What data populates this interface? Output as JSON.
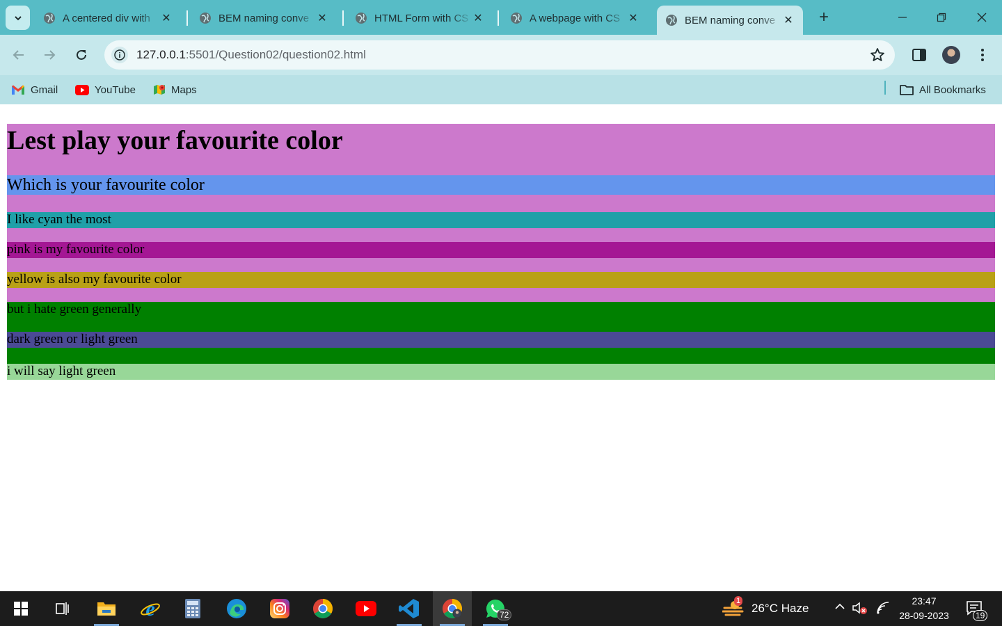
{
  "browser": {
    "tabs": [
      {
        "title": "A centered div with",
        "active": false
      },
      {
        "title": "BEM naming conve",
        "active": false
      },
      {
        "title": "HTML Form with CS",
        "active": false
      },
      {
        "title": "A webpage with CS",
        "active": false
      },
      {
        "title": "BEM naming conve",
        "active": true
      }
    ],
    "close_glyph": "✕",
    "new_tab_glyph": "+",
    "url_host": "127.0.0.1",
    "url_path": ":5501/Question02/question02.html",
    "bookmarks": [
      {
        "label": "Gmail",
        "icon": "gmail-icon"
      },
      {
        "label": "YouTube",
        "icon": "youtube-icon"
      },
      {
        "label": "Maps",
        "icon": "maps-icon"
      }
    ],
    "all_bookmarks_label": "All Bookmarks"
  },
  "page": {
    "heading": "Lest play your favourite color",
    "subheading": "Which is your favourite color",
    "rows": {
      "cyan": "I like cyan the most",
      "pink": "pink is my favourite color",
      "yellow": "yellow is also my favourite color",
      "green": "but i hate green generally",
      "dark": "dark green or light green",
      "light": "i will say light green"
    },
    "colors": {
      "container": "#cc79cc",
      "subheading": "#6495ed",
      "cyan": "#20a0a8",
      "pink": "#a41794",
      "yellow": "#b9a116",
      "green": "#008000",
      "dark": "#4b4a95",
      "light": "#98d798"
    }
  },
  "taskbar": {
    "apps": [
      "windows-start",
      "task-view",
      "file-explorer",
      "internet-explorer",
      "calculator",
      "edge",
      "instagram",
      "chrome",
      "youtube",
      "vscode",
      "chrome-profile",
      "whatsapp"
    ],
    "whatsapp_badge": "72",
    "weather_badge": "1",
    "weather": "26°C  Haze",
    "time": "23:47",
    "date": "28-09-2023",
    "notification_count": "19"
  }
}
